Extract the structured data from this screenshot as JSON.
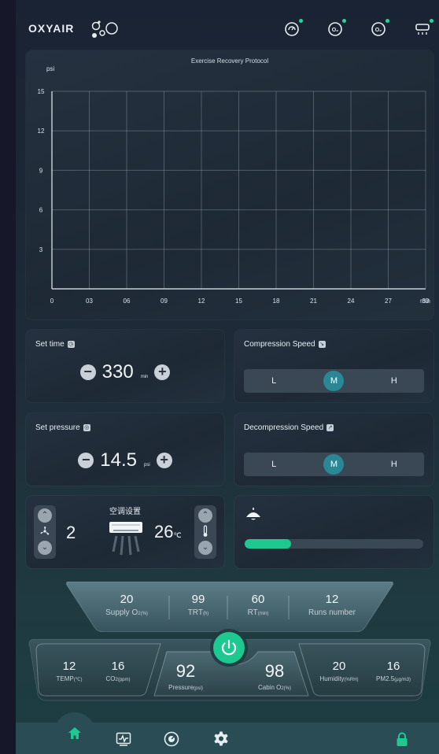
{
  "header": {
    "logo_text": "OXYAIR",
    "status_icons": [
      "gauge-icon",
      "o2-sensor-icon",
      "o2-sensor-icon",
      "ac-unit-icon"
    ]
  },
  "chart_data": {
    "type": "line",
    "title": "Exercise Recovery Protocol",
    "ylabel": "psi",
    "xlabel": "min",
    "ylim": [
      0,
      15
    ],
    "y_ticks": [
      "15",
      "12",
      "9",
      "6",
      "3"
    ],
    "x_ticks": [
      "0",
      "03",
      "06",
      "09",
      "12",
      "15",
      "18",
      "21",
      "24",
      "27",
      "30"
    ],
    "xlim": [
      0,
      30
    ],
    "grid": true,
    "series": []
  },
  "set_time": {
    "title": "Set time",
    "value": "330",
    "unit": "min"
  },
  "set_pressure": {
    "title": "Set pressure",
    "value": "14.5",
    "unit": "psi"
  },
  "compression": {
    "title": "Compression Speed",
    "options": [
      "L",
      "M",
      "H"
    ],
    "selected": "M"
  },
  "decompression": {
    "title": "Decompression Speed",
    "options": [
      "L",
      "M",
      "H"
    ],
    "selected": "M"
  },
  "ac": {
    "title": "空调设置",
    "fan_level": "2",
    "temperature": "26",
    "temp_unit": "℃"
  },
  "light": {
    "level": 0.26,
    "accent": "#1dc98f"
  },
  "stats_top": [
    {
      "value": "20",
      "label": "Supply O",
      "sub": "2(%)"
    },
    {
      "value": "99",
      "label": "TRT",
      "sub": "(h)"
    },
    {
      "value": "60",
      "label": "RT",
      "sub": "(min)"
    },
    {
      "value": "12",
      "label": "Runs number",
      "sub": ""
    }
  ],
  "stats_bottom": {
    "temp": {
      "value": "12",
      "label": "TEMP",
      "sub": "(℃)"
    },
    "co2": {
      "value": "16",
      "label": "CO",
      "sub": "2(ppm)"
    },
    "pressure": {
      "value": "92",
      "label": "Pressure",
      "sub": "(psi)"
    },
    "cabin_o2": {
      "value": "98",
      "label": "Cabin O",
      "sub": "2(%)"
    },
    "humidity": {
      "value": "20",
      "label": "Humidity",
      "sub": "(%RH)"
    },
    "pm25": {
      "value": "16",
      "label": "PM2.5",
      "sub": "(μg/m3)"
    }
  },
  "nav": [
    "home-icon",
    "monitor-icon",
    "gauge-icon",
    "settings-icon",
    "lock-icon"
  ],
  "colors": {
    "accent": "#1dc98f",
    "selected": "#2a8896"
  }
}
